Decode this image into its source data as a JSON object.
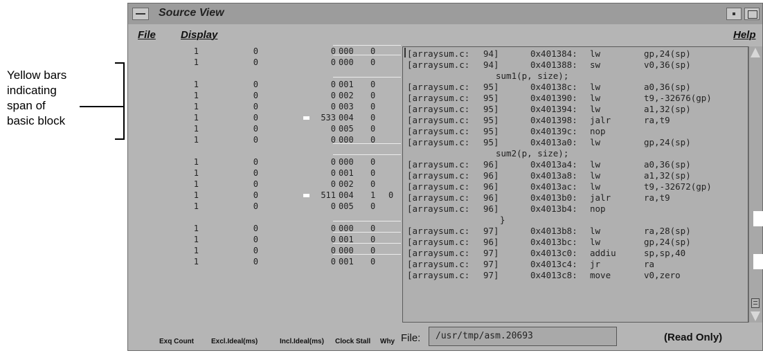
{
  "annotation": {
    "lines": [
      "Yellow bars",
      "indicating",
      "span of",
      "basic block"
    ]
  },
  "window": {
    "title": "Source View"
  },
  "menu": {
    "file": "File",
    "display": "Display",
    "help": "Help"
  },
  "columns": {
    "exq_count": "Exq Count",
    "excl_ideal": "Excl.Ideal(ms)",
    "incl_ideal": "Incl.Ideal(ms)",
    "clock_stall": "Clock Stall",
    "why": "Why"
  },
  "file": {
    "label": "File:",
    "value": "/usr/tmp/asm.20693",
    "status": "(Read Only)"
  },
  "stats_rows": [
    {
      "c1": "1",
      "c2": "0",
      "c3": "0",
      "c4": "000",
      "c5": "0",
      "c6": "",
      "bar": false
    },
    {
      "c1": "1",
      "c2": "0",
      "c3": "0",
      "c4": "000",
      "c5": "0",
      "c6": "",
      "bar": false
    },
    {
      "c1": "1",
      "c2": "0",
      "c3": "0",
      "c4": "001",
      "c5": "0",
      "c6": "",
      "bar": false
    },
    {
      "c1": "1",
      "c2": "0",
      "c3": "0",
      "c4": "002",
      "c5": "0",
      "c6": "",
      "bar": false
    },
    {
      "c1": "1",
      "c2": "0",
      "c3": "0",
      "c4": "003",
      "c5": "0",
      "c6": "",
      "bar": false
    },
    {
      "c1": "1",
      "c2": "0",
      "c3": "533",
      "c4": "004",
      "c5": "0",
      "c6": "",
      "bar": true
    },
    {
      "c1": "1",
      "c2": "0",
      "c3": "0",
      "c4": "005",
      "c5": "0",
      "c6": "",
      "bar": false
    },
    {
      "c1": "1",
      "c2": "0",
      "c3": "0",
      "c4": "000",
      "c5": "0",
      "c6": "",
      "bar": false
    },
    {
      "c1": "1",
      "c2": "0",
      "c3": "0",
      "c4": "000",
      "c5": "0",
      "c6": "",
      "bar": false
    },
    {
      "c1": "1",
      "c2": "0",
      "c3": "0",
      "c4": "001",
      "c5": "0",
      "c6": "",
      "bar": false
    },
    {
      "c1": "1",
      "c2": "0",
      "c3": "0",
      "c4": "002",
      "c5": "0",
      "c6": "",
      "bar": false
    },
    {
      "c1": "1",
      "c2": "0",
      "c3": "511",
      "c4": "004",
      "c5": "1",
      "c6": "0",
      "bar": true
    },
    {
      "c1": "1",
      "c2": "0",
      "c3": "0",
      "c4": "005",
      "c5": "0",
      "c6": "",
      "bar": false
    },
    {
      "c1": "1",
      "c2": "0",
      "c3": "0",
      "c4": "000",
      "c5": "0",
      "c6": "",
      "bar": false
    },
    {
      "c1": "1",
      "c2": "0",
      "c3": "0",
      "c4": "001",
      "c5": "0",
      "c6": "",
      "bar": false
    },
    {
      "c1": "1",
      "c2": "0",
      "c3": "0",
      "c4": "000",
      "c5": "0",
      "c6": "",
      "bar": false
    },
    {
      "c1": "1",
      "c2": "0",
      "c3": "0",
      "c4": "001",
      "c5": "0",
      "c6": "",
      "bar": false
    }
  ],
  "code_lines": [
    {
      "file": "[arraysum.c:",
      "line": "94]",
      "addr": "0x401384:",
      "op": "lw",
      "args": "gp,24(sp)"
    },
    {
      "file": "[arraysum.c:",
      "line": "94]",
      "addr": "0x401388:",
      "op": "sw",
      "args": "v0,36(sp)"
    },
    {
      "src": "sum1(p, size);"
    },
    {
      "file": "[arraysum.c:",
      "line": "95]",
      "addr": "0x40138c:",
      "op": "lw",
      "args": "a0,36(sp)"
    },
    {
      "file": "[arraysum.c:",
      "line": "95]",
      "addr": "0x401390:",
      "op": "lw",
      "args": "t9,-32676(gp)"
    },
    {
      "file": "[arraysum.c:",
      "line": "95]",
      "addr": "0x401394:",
      "op": "lw",
      "args": "a1,32(sp)"
    },
    {
      "file": "[arraysum.c:",
      "line": "95]",
      "addr": "0x401398:",
      "op": "jalr",
      "args": "ra,t9"
    },
    {
      "file": "[arraysum.c:",
      "line": "95]",
      "addr": "0x40139c:",
      "op": "nop",
      "args": ""
    },
    {
      "file": "[arraysum.c:",
      "line": "95]",
      "addr": "0x4013a0:",
      "op": "lw",
      "args": "gp,24(sp)"
    },
    {
      "src": "sum2(p, size);"
    },
    {
      "file": "[arraysum.c:",
      "line": "96]",
      "addr": "0x4013a4:",
      "op": "lw",
      "args": "a0,36(sp)"
    },
    {
      "file": "[arraysum.c:",
      "line": "96]",
      "addr": "0x4013a8:",
      "op": "lw",
      "args": "a1,32(sp)"
    },
    {
      "file": "[arraysum.c:",
      "line": "96]",
      "addr": "0x4013ac:",
      "op": "lw",
      "args": "t9,-32672(gp)"
    },
    {
      "file": "[arraysum.c:",
      "line": "96]",
      "addr": "0x4013b0:",
      "op": "jalr",
      "args": "ra,t9"
    },
    {
      "file": "[arraysum.c:",
      "line": "96]",
      "addr": "0x4013b4:",
      "op": "nop",
      "args": ""
    },
    {
      "src": "}"
    },
    {
      "file": "[arraysum.c:",
      "line": "97]",
      "addr": "0x4013b8:",
      "op": "lw",
      "args": "ra,28(sp)"
    },
    {
      "file": "[arraysum.c:",
      "line": "96]",
      "addr": "0x4013bc:",
      "op": "lw",
      "args": "gp,24(sp)"
    },
    {
      "file": "[arraysum.c:",
      "line": "97]",
      "addr": "0x4013c0:",
      "op": "addiu",
      "args": "sp,sp,40"
    },
    {
      "file": "[arraysum.c:",
      "line": "97]",
      "addr": "0x4013c4:",
      "op": "jr",
      "args": "ra"
    },
    {
      "file": "[arraysum.c:",
      "line": "97]",
      "addr": "0x4013c8:",
      "op": "move",
      "args": "v0,zero"
    }
  ]
}
